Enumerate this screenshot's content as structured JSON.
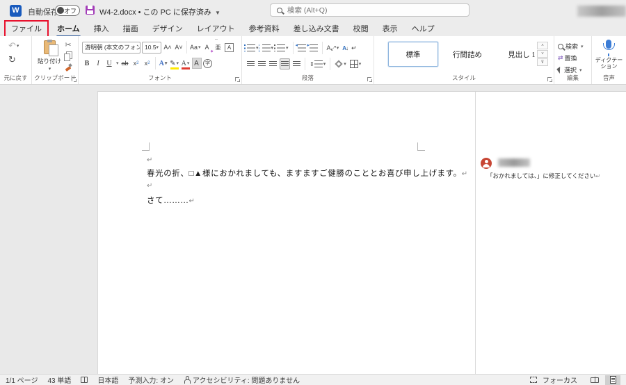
{
  "titlebar": {
    "app_initial": "W",
    "autosave_label": "自動保存",
    "autosave_state": "オフ",
    "doc_title": "W4-2.docx • この PC に保存済み",
    "search_placeholder": "検索 (Alt+Q)"
  },
  "tabs": [
    "ファイル",
    "ホーム",
    "挿入",
    "描画",
    "デザイン",
    "レイアウト",
    "参考資料",
    "差し込み文書",
    "校閲",
    "表示",
    "ヘルプ"
  ],
  "ribbon": {
    "undo": {
      "label": "元に戻す",
      "undo_glyph": "↶",
      "redo_glyph": "↻"
    },
    "clipboard": {
      "label": "クリップボード",
      "paste": "貼り付け",
      "cut_glyph": "✂"
    },
    "font": {
      "label": "フォント",
      "name": "游明朝 (本文のフォント)",
      "size": "10.5",
      "glyphs": {
        "grow": "A˄",
        "shrink": "A˅",
        "case": "Aa",
        "clear": "A",
        "ruby": "亜",
        "enclose": "A",
        "bold": "B",
        "italic": "I",
        "underline": "U",
        "strike": "ab",
        "sub": "x",
        "sup": "x",
        "effects": "A",
        "highlight": "✎",
        "color": "A",
        "shading": "A",
        "circle": "字"
      }
    },
    "paragraph": {
      "label": "段落",
      "sort_glyph": "A↓",
      "marks_glyph": "↵",
      "spacing_glyph": "⇕"
    },
    "styles": {
      "label": "スタイル",
      "items": [
        "標準",
        "行間詰め",
        "見出し 1"
      ],
      "scroll_up": "˄",
      "scroll_down": "˅",
      "scroll_more": "⊽"
    },
    "editing": {
      "label": "編集",
      "search": "検索",
      "replace": "置換",
      "select": "選択",
      "replace_glyph": "⇄"
    },
    "voice": {
      "label": "音声",
      "dictate_line1": "ディクテー",
      "dictate_line2": "ション"
    }
  },
  "document": {
    "pilcrow": "↵",
    "line1": "春光の折、□▲様におかれましても、ますますご健勝のこととお喜び申し上げます。",
    "line2": "さて………"
  },
  "comment": {
    "text": "「おかれましては、」に修正してください"
  },
  "statusbar": {
    "page": "1/1 ページ",
    "words": "43 単語",
    "language": "日本語",
    "ime": "予測入力: オン",
    "accessibility": "アクセシビリティ: 問題ありません",
    "focus": "フォーカス"
  }
}
